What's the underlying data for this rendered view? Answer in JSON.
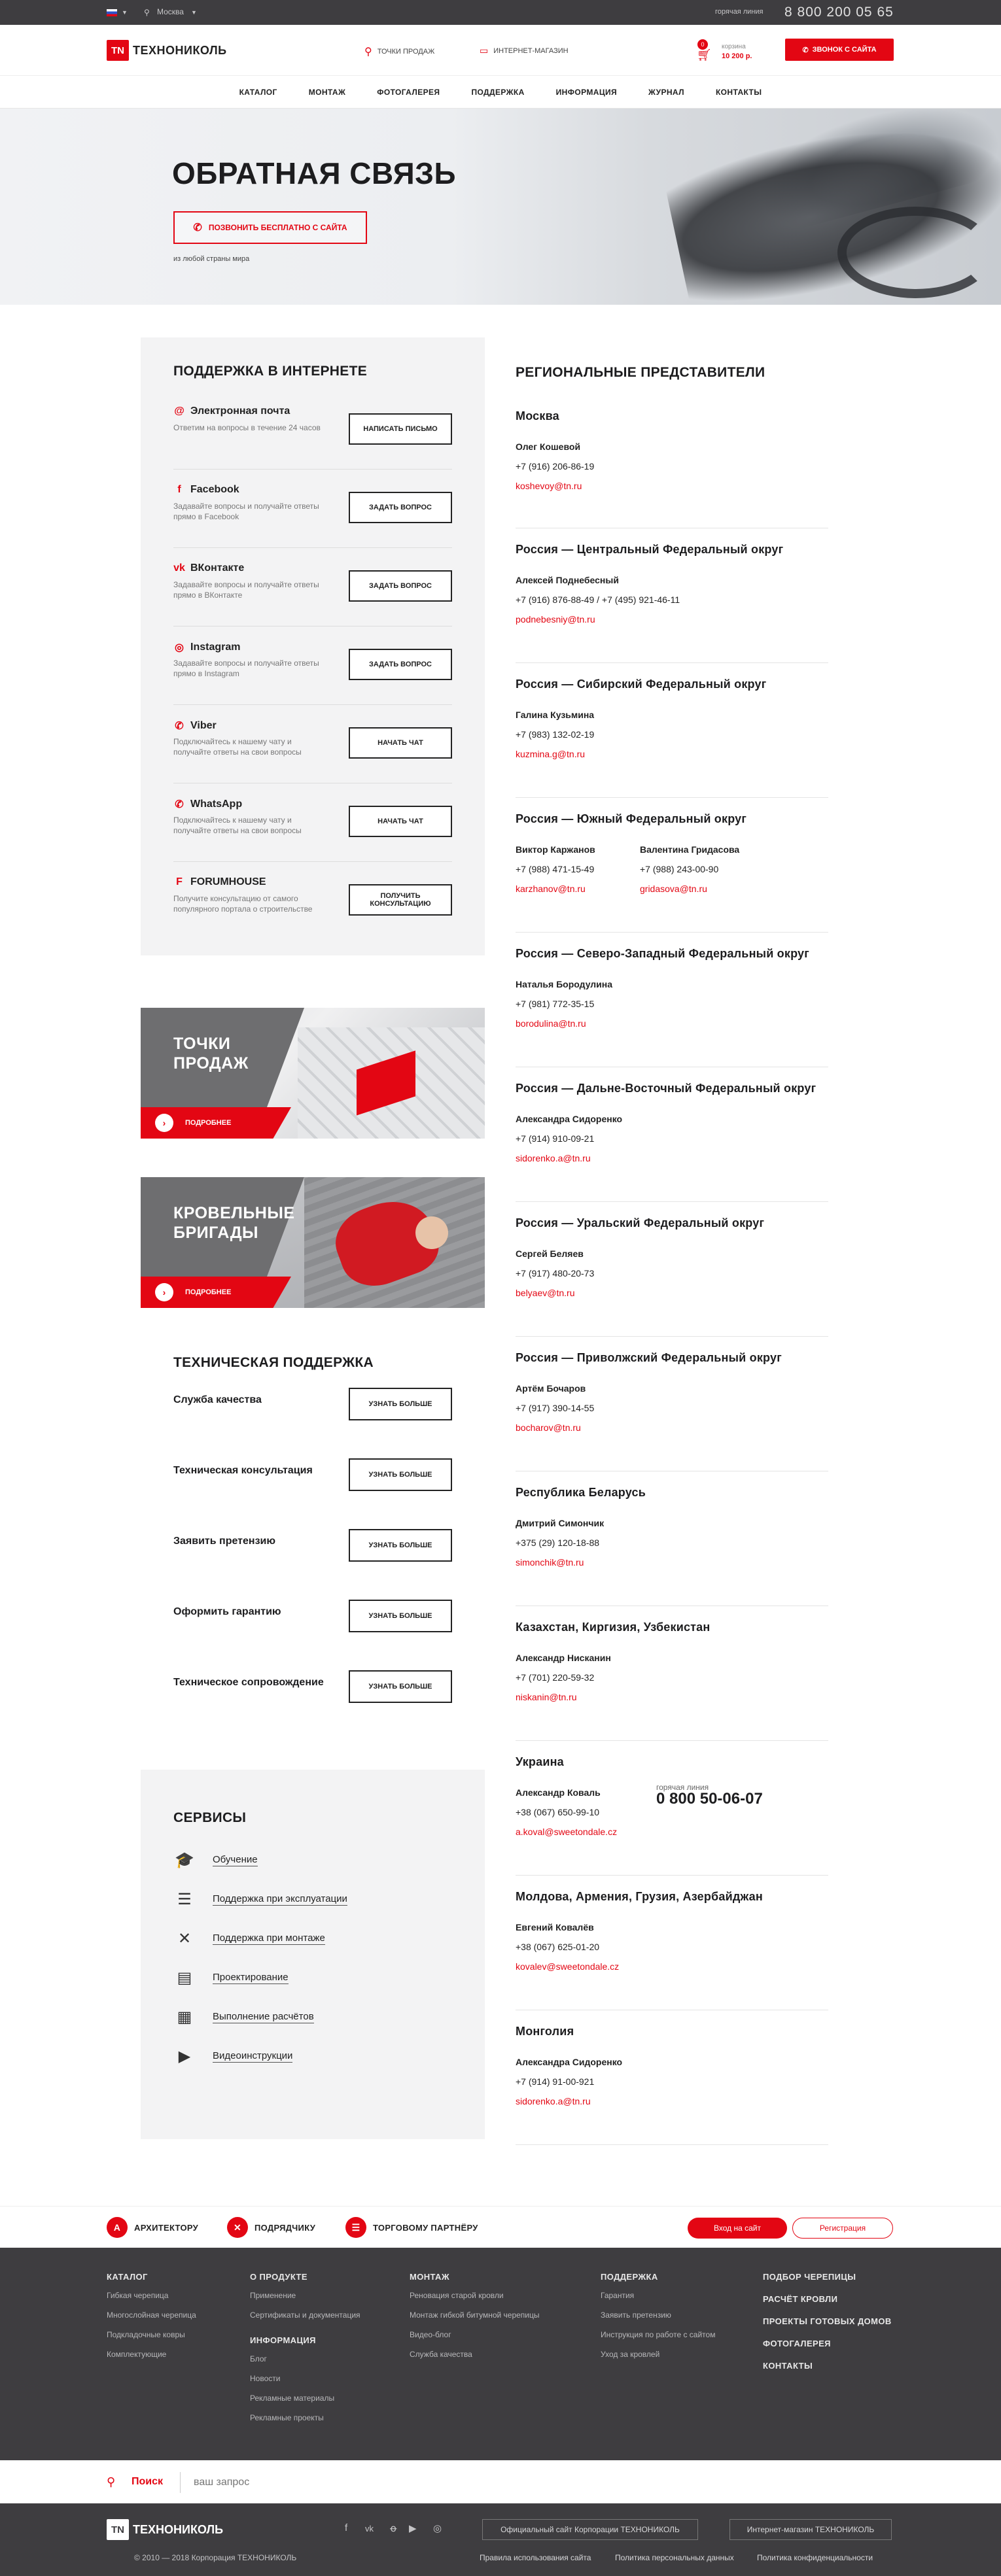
{
  "topbar": {
    "city": "Москва",
    "hotline_label": "горячая линия",
    "hotline_phone": "8 800 200 05 65"
  },
  "header": {
    "logo_mark": "TN",
    "logo_text": "ТЕХНОНИКОЛЬ",
    "link_points": "ТОЧКИ ПРОДАЖ",
    "link_shop": "ИНТЕРНЕТ-МАГАЗИН",
    "cart_count": "0",
    "cart_label": "корзина",
    "cart_sum": "10 200 р.",
    "call_button": "ЗВОНОК С САЙТА"
  },
  "nav": [
    "КАТАЛОГ",
    "МОНТАЖ",
    "ФОТОГАЛЕРЕЯ",
    "ПОДДЕРЖКА",
    "ИНФОРМАЦИЯ",
    "ЖУРНАЛ",
    "КОНТАКТЫ"
  ],
  "hero": {
    "title": "ОБРАТНАЯ СВЯЗЬ",
    "button": "ПОЗВОНИТЬ БЕСПЛАТНО С САЙТА",
    "note": "из любой страны мира"
  },
  "support": {
    "title": "ПОДДЕРЖКА В ИНТЕРНЕТЕ",
    "items": [
      {
        "icon": "email-icon",
        "glyph": "@",
        "name": "Электронная почта",
        "desc": "Ответим на вопросы в течение 24 часов",
        "button": "НАПИСАТЬ ПИСЬМО"
      },
      {
        "icon": "facebook-icon",
        "glyph": "f",
        "name": "Facebook",
        "desc": "Задавайте вопросы и получайте ответы прямо в Facebook",
        "button": "ЗАДАТЬ ВОПРОС"
      },
      {
        "icon": "vk-icon",
        "glyph": "vk",
        "name": "ВКонтакте",
        "desc": "Задавайте вопросы и получайте ответы прямо в ВКонтакте",
        "button": "ЗАДАТЬ ВОПРОС"
      },
      {
        "icon": "instagram-icon",
        "glyph": "◎",
        "name": "Instagram",
        "desc": "Задавайте вопросы и получайте ответы прямо в Instagram",
        "button": "ЗАДАТЬ ВОПРОС"
      },
      {
        "icon": "viber-icon",
        "glyph": "✆",
        "name": "Viber",
        "desc": "Подключайтесь к нашему чату и получайте ответы на свои вопросы",
        "button": "НАЧАТЬ ЧАТ"
      },
      {
        "icon": "whatsapp-icon",
        "glyph": "✆",
        "name": "WhatsApp",
        "desc": "Подключайтесь к нашему чату и получайте ответы на свои вопросы",
        "button": "НАЧАТЬ ЧАТ"
      },
      {
        "icon": "forumhouse-icon",
        "glyph": "F",
        "name": "FORUMHOUSE",
        "desc": "Получите консультацию от самого популярного портала о строительстве",
        "button": "ПОЛУЧИТЬ КОНСУЛЬТАЦИЮ"
      }
    ]
  },
  "banners": [
    {
      "title": "ТОЧКИ\nПРОДАЖ",
      "more": "ПОДРОБНЕЕ"
    },
    {
      "title": "КРОВЕЛЬНЫЕ\nБРИГАДЫ",
      "more": "ПОДРОБНЕЕ"
    }
  ],
  "tech": {
    "title": "ТЕХНИЧЕСКАЯ ПОДДЕРЖКА",
    "rows": [
      {
        "label": "Служба качества",
        "button": "УЗНАТЬ БОЛЬШЕ"
      },
      {
        "label": "Техническая консультация",
        "button": "УЗНАТЬ БОЛЬШЕ"
      },
      {
        "label": "Заявить претензию",
        "button": "УЗНАТЬ БОЛЬШЕ"
      },
      {
        "label": "Оформить гарантию",
        "button": "УЗНАТЬ БОЛЬШЕ"
      },
      {
        "label": "Техническое сопровождение",
        "button": "УЗНАТЬ БОЛЬШЕ"
      }
    ]
  },
  "services": {
    "title": "СЕРВИСЫ",
    "items": [
      {
        "icon": "graduation-cap-icon",
        "glyph": "🎓",
        "label": "Обучение"
      },
      {
        "icon": "document-list-icon",
        "glyph": "☰",
        "label": "Поддержка при эксплуатации"
      },
      {
        "icon": "tools-icon",
        "glyph": "✕",
        "label": "Поддержка при монтаже"
      },
      {
        "icon": "blueprint-icon",
        "glyph": "▤",
        "label": "Проектирование"
      },
      {
        "icon": "calculator-icon",
        "glyph": "▦",
        "label": "Выполнение расчётов"
      },
      {
        "icon": "video-icon",
        "glyph": "▶",
        "label": "Видеоинструкции"
      }
    ]
  },
  "regional": {
    "title": "РЕГИОНАЛЬНЫЕ ПРЕДСТАВИТЕЛИ",
    "regions": [
      {
        "name": "Москва",
        "people": [
          {
            "name": "Олег Кошевой",
            "phone": "+7 (916) 206-86-19",
            "email": "koshevoy@tn.ru"
          }
        ]
      },
      {
        "name": "Россия — Центральный Федеральный округ",
        "people": [
          {
            "name": "Алексей Поднебесный",
            "phone": "+7 (916) 876-88-49  /  +7 (495) 921-46-11",
            "email": "podnebesniy@tn.ru"
          }
        ]
      },
      {
        "name": "Россия — Сибирский Федеральный округ",
        "people": [
          {
            "name": "Галина Кузьмина",
            "phone": "+7 (983) 132-02-19",
            "email": "kuzmina.g@tn.ru"
          }
        ]
      },
      {
        "name": "Россия — Южный Федеральный округ",
        "people": [
          {
            "name": "Виктор Каржанов",
            "phone": "+7 (988) 471-15-49",
            "email": "karzhanov@tn.ru"
          },
          {
            "name": "Валентина Гридасова",
            "phone": "+7 (988) 243-00-90",
            "email": "gridasova@tn.ru"
          }
        ]
      },
      {
        "name": "Россия — Северо-Западный Федеральный округ",
        "people": [
          {
            "name": "Наталья Бородулина",
            "phone": "+7 (981) 772-35-15",
            "email": "borodulina@tn.ru"
          }
        ]
      },
      {
        "name": "Россия — Дальне-Восточный Федеральный округ",
        "people": [
          {
            "name": "Александра Сидоренко",
            "phone": "+7 (914) 910-09-21",
            "email": "sidorenko.a@tn.ru"
          }
        ]
      },
      {
        "name": "Россия — Уральский Федеральный округ",
        "people": [
          {
            "name": "Сергей Беляев",
            "phone": "+7 (917) 480-20-73",
            "email": "belyaev@tn.ru"
          }
        ]
      },
      {
        "name": "Россия — Приволжский Федеральный округ",
        "people": [
          {
            "name": "Артём Бочаров",
            "phone": "+7 (917) 390-14-55",
            "email": "bocharov@tn.ru"
          }
        ]
      },
      {
        "name": "Республика Беларусь",
        "people": [
          {
            "name": "Дмитрий Симончик",
            "phone": "+375 (29) 120-18-88",
            "email": "simonchik@tn.ru"
          }
        ]
      },
      {
        "name": "Казахстан, Киргизия, Узбекистан",
        "people": [
          {
            "name": "Александр Нисканин",
            "phone": "+7 (701) 220-59-32",
            "email": "niskanin@tn.ru"
          }
        ]
      },
      {
        "name": "Украина",
        "people": [
          {
            "name": "Александр Коваль",
            "phone": "+38 (067) 650-99-10",
            "email": "a.koval@sweetondale.cz"
          }
        ],
        "hotline_label": "горячая линия",
        "hotline_phone": "0 800 50-06-07"
      },
      {
        "name": "Молдова, Армения, Грузия, Азербайджан",
        "people": [
          {
            "name": "Евгений Ковалёв",
            "phone": "+38 (067) 625-01-20",
            "email": "kovalev@sweetondale.cz"
          }
        ]
      },
      {
        "name": "Монголия",
        "people": [
          {
            "name": "Александра Сидоренко",
            "phone": "+7 (914) 91-00-921",
            "email": "sidorenko.a@tn.ru"
          }
        ]
      }
    ]
  },
  "roles": {
    "architect": "АРХИТЕКТОРУ",
    "contractor": "ПОДРЯДЧИКУ",
    "partner": "ТОРГОВОМУ ПАРТНЁРУ",
    "login": "Вход на сайт",
    "register": "Регистрация"
  },
  "footer": {
    "columns": [
      {
        "title": "КАТАЛОГ",
        "items": [
          "Гибкая черепица",
          "Многослойная черепица",
          "Подкладочные ковры",
          "Комплектующие"
        ]
      },
      {
        "title": "О ПРОДУКТЕ",
        "items": [
          "Применение",
          "Сертификаты и документация"
        ],
        "title2": "ИНФОРМАЦИЯ",
        "items2": [
          "Блог",
          "Новости",
          "Рекламные материалы",
          "Рекламные проекты"
        ]
      },
      {
        "title": "МОНТАЖ",
        "items": [
          "Реновация старой кровли",
          "Монтаж гибкой битумной черепицы",
          "Видео-блог",
          "Служба качества"
        ]
      },
      {
        "title": "ПОДДЕРЖКА",
        "items": [
          "Гарантия",
          "Заявить претензию",
          "Инструкция по работе с сайтом",
          "Уход за кровлей"
        ]
      },
      {
        "title": "ПОДБОР ЧЕРЕПИЦЫ",
        "items": [],
        "extra": [
          "РАСЧЁТ КРОВЛИ",
          "ПРОЕКТЫ ГОТОВЫХ ДОМОВ",
          "ФОТОГАЛЕРЕЯ",
          "КОНТАКТЫ"
        ]
      }
    ]
  },
  "search": {
    "label": "Поиск",
    "placeholder": "ваш запрос"
  },
  "bottom": {
    "logo_mark": "TN",
    "logo_text": "ТЕХНОНИКОЛЬ",
    "official_site": "Официальный сайт Корпорации ТЕХНОНИКОЛЬ",
    "shop": "Интернет-магазин ТЕХНОНИКОЛЬ",
    "copyright": "© 2010 — 2018 Корпорация ТЕХНОНИКОЛЬ",
    "links": [
      "Правила использования сайта",
      "Политика персональных данных",
      "Политика конфиденциальности"
    ]
  },
  "colors": {
    "accent": "#e30613",
    "dark": "#3e3d40"
  }
}
